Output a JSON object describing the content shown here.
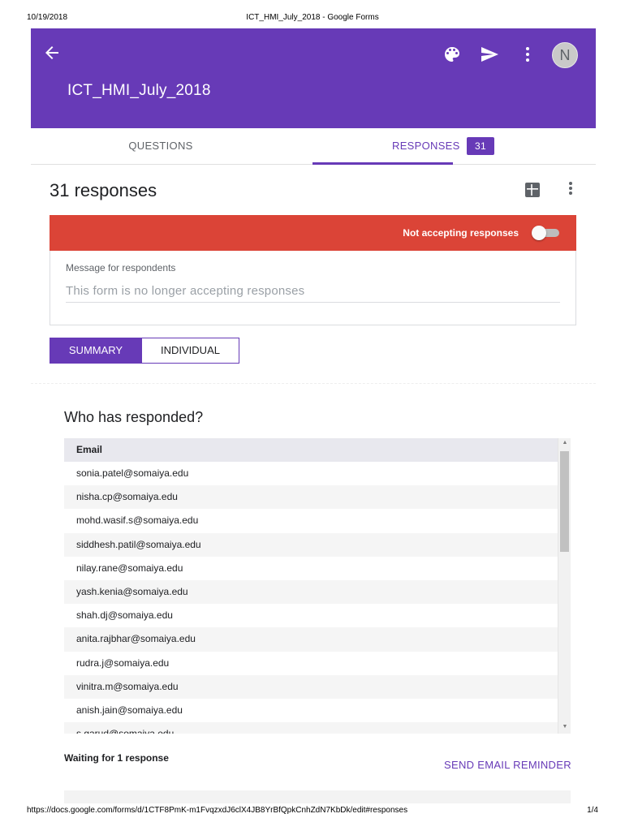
{
  "print_header": {
    "date": "10/19/2018",
    "title": "ICT_HMI_July_2018 - Google Forms"
  },
  "header": {
    "form_title": "ICT_HMI_July_2018",
    "avatar_initial": "N",
    "icons": [
      "back-arrow-icon",
      "palette-icon",
      "send-icon",
      "more-vert-icon"
    ],
    "brand_color": "#673ab7"
  },
  "tabs": {
    "questions_label": "QUESTIONS",
    "responses_label": "RESPONSES",
    "responses_count": "31",
    "active": "responses"
  },
  "responses": {
    "title": "31 responses",
    "accepting_label": "Not accepting responses",
    "accepting_on": false,
    "accent_color": "#db4437",
    "message_label": "Message for respondents",
    "message_value": "This form is no longer accepting responses"
  },
  "view_toggle": {
    "summary_label": "SUMMARY",
    "individual_label": "INDIVIDUAL",
    "active": "summary"
  },
  "who": {
    "title": "Who has responded?",
    "column_header": "Email",
    "emails": [
      "sonia.patel@somaiya.edu",
      "nisha.cp@somaiya.edu",
      "mohd.wasif.s@somaiya.edu",
      "siddhesh.patil@somaiya.edu",
      "nilay.rane@somaiya.edu",
      "yash.kenia@somaiya.edu",
      "shah.dj@somaiya.edu",
      "anita.rajbhar@somaiya.edu",
      "rudra.j@somaiya.edu",
      "vinitra.m@somaiya.edu",
      "anish.jain@somaiya.edu",
      "s.garud@somaiya.edu"
    ]
  },
  "waiting": {
    "label": "Waiting for 1 response",
    "reminder_label": "SEND EMAIL REMINDER"
  },
  "print_footer": {
    "url": "https://docs.google.com/forms/d/1CTF8PmK-m1FvqzxdJ6clX4JB8YrBfQpkCnhZdN7KbDk/edit#responses",
    "page": "1/4"
  }
}
